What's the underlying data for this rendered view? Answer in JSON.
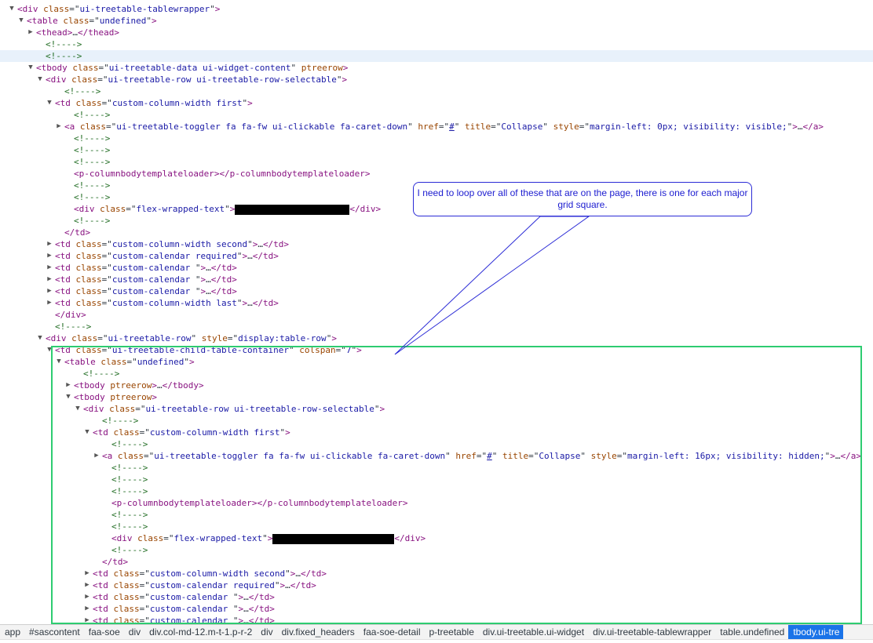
{
  "tree_lines": [
    {
      "indent": 22,
      "toggle": "down",
      "kind": "open",
      "tag": "div",
      "attrs": [
        [
          "class",
          "ui-treetable-tablewrapper"
        ]
      ]
    },
    {
      "indent": 34,
      "toggle": "down",
      "kind": "open",
      "tag": "table",
      "attrs": [
        [
          "class",
          "undefined"
        ]
      ]
    },
    {
      "indent": 46,
      "toggle": "right",
      "kind": "collapsed",
      "tag": "thead",
      "attrs": []
    },
    {
      "indent": 58,
      "kind": "comment",
      "text": "<!---->"
    },
    {
      "indent": 58,
      "kind": "comment",
      "text": "<!---->",
      "highlight": true
    },
    {
      "indent": 46,
      "toggle": "down",
      "kind": "open",
      "tag": "tbody",
      "attrs": [
        [
          "class",
          "ui-treetable-data ui-widget-content"
        ],
        [
          "ptreerow",
          null
        ]
      ]
    },
    {
      "indent": 58,
      "toggle": "down",
      "kind": "open",
      "tag": "div",
      "attrs": [
        [
          "class",
          "ui-treetable-row ui-treetable-row-selectable"
        ]
      ]
    },
    {
      "indent": 82,
      "kind": "comment",
      "text": "<!---->"
    },
    {
      "indent": 70,
      "toggle": "down",
      "kind": "open",
      "tag": "td",
      "attrs": [
        [
          "class",
          "custom-column-width first"
        ]
      ]
    },
    {
      "indent": 94,
      "kind": "comment",
      "text": "<!---->"
    },
    {
      "indent": 82,
      "toggle": "right",
      "kind": "collapsed",
      "tag": "a",
      "attrs": [
        [
          "class",
          "ui-treetable-toggler fa fa-fw ui-clickable fa-caret-down"
        ],
        [
          "href",
          "#"
        ],
        [
          "title",
          "Collapse"
        ],
        [
          "style",
          "margin-left: 0px; visibility: visible;"
        ]
      ]
    },
    {
      "indent": 94,
      "kind": "comment",
      "text": "<!---->"
    },
    {
      "indent": 94,
      "kind": "comment",
      "text": "<!---->"
    },
    {
      "indent": 94,
      "kind": "comment",
      "text": "<!---->"
    },
    {
      "indent": 94,
      "kind": "empty",
      "tag": "p-columnbodytemplateloader",
      "attrs": []
    },
    {
      "indent": 94,
      "kind": "comment",
      "text": "<!---->"
    },
    {
      "indent": 94,
      "kind": "comment",
      "text": "<!---->"
    },
    {
      "indent": 94,
      "kind": "redacted",
      "tag": "div",
      "attrs": [
        [
          "class",
          "flex-wrapped-text"
        ]
      ],
      "redact_width": 146
    },
    {
      "indent": 94,
      "kind": "comment",
      "text": "<!---->"
    },
    {
      "indent": 82,
      "kind": "close",
      "tag": "td"
    },
    {
      "indent": 70,
      "toggle": "right",
      "kind": "collapsed",
      "tag": "td",
      "attrs": [
        [
          "class",
          "custom-column-width second"
        ]
      ]
    },
    {
      "indent": 70,
      "toggle": "right",
      "kind": "collapsed",
      "tag": "td",
      "attrs": [
        [
          "class",
          "custom-calendar required"
        ]
      ]
    },
    {
      "indent": 70,
      "toggle": "right",
      "kind": "collapsed",
      "tag": "td",
      "attrs": [
        [
          "class",
          "custom-calendar "
        ]
      ]
    },
    {
      "indent": 70,
      "toggle": "right",
      "kind": "collapsed",
      "tag": "td",
      "attrs": [
        [
          "class",
          "custom-calendar "
        ]
      ]
    },
    {
      "indent": 70,
      "toggle": "right",
      "kind": "collapsed",
      "tag": "td",
      "attrs": [
        [
          "class",
          "custom-calendar "
        ]
      ]
    },
    {
      "indent": 70,
      "toggle": "right",
      "kind": "collapsed",
      "tag": "td",
      "attrs": [
        [
          "class",
          "custom-column-width last"
        ]
      ]
    },
    {
      "indent": 70,
      "kind": "close",
      "tag": "div"
    },
    {
      "indent": 70,
      "kind": "comment",
      "text": "<!---->"
    },
    {
      "indent": 58,
      "toggle": "down",
      "kind": "open",
      "tag": "div",
      "attrs": [
        [
          "class",
          "ui-treetable-row"
        ],
        [
          "style",
          "display:table-row"
        ]
      ]
    },
    {
      "indent": 70,
      "toggle": "down",
      "kind": "open",
      "tag": "td",
      "attrs": [
        [
          "class",
          "ui-treetable-child-table-container"
        ],
        [
          "colspan",
          "7"
        ]
      ]
    },
    {
      "indent": 82,
      "toggle": "down",
      "kind": "open",
      "tag": "table",
      "attrs": [
        [
          "class",
          "undefined"
        ]
      ]
    },
    {
      "indent": 106,
      "kind": "comment",
      "text": "<!---->"
    },
    {
      "indent": 94,
      "toggle": "right",
      "kind": "collapsed",
      "tag": "tbody",
      "attrs": [
        [
          "ptreerow",
          null
        ]
      ]
    },
    {
      "indent": 94,
      "toggle": "down",
      "kind": "open",
      "tag": "tbody",
      "attrs": [
        [
          "ptreerow",
          null
        ]
      ]
    },
    {
      "indent": 106,
      "toggle": "down",
      "kind": "open",
      "tag": "div",
      "attrs": [
        [
          "class",
          "ui-treetable-row ui-treetable-row-selectable"
        ]
      ]
    },
    {
      "indent": 130,
      "kind": "comment",
      "text": "<!---->"
    },
    {
      "indent": 118,
      "toggle": "down",
      "kind": "open",
      "tag": "td",
      "attrs": [
        [
          "class",
          "custom-column-width first"
        ]
      ]
    },
    {
      "indent": 142,
      "kind": "comment",
      "text": "<!---->"
    },
    {
      "indent": 130,
      "toggle": "right",
      "kind": "collapsed",
      "tag": "a",
      "attrs": [
        [
          "class",
          "ui-treetable-toggler fa fa-fw ui-clickable fa-caret-down"
        ],
        [
          "href",
          "#"
        ],
        [
          "title",
          "Collapse"
        ],
        [
          "style",
          "margin-left: 16px; visibility: hidden;"
        ]
      ]
    },
    {
      "indent": 142,
      "kind": "comment",
      "text": "<!---->"
    },
    {
      "indent": 142,
      "kind": "comment",
      "text": "<!---->"
    },
    {
      "indent": 142,
      "kind": "comment",
      "text": "<!---->"
    },
    {
      "indent": 142,
      "kind": "empty",
      "tag": "p-columnbodytemplateloader",
      "attrs": []
    },
    {
      "indent": 142,
      "kind": "comment",
      "text": "<!---->"
    },
    {
      "indent": 142,
      "kind": "comment",
      "text": "<!---->"
    },
    {
      "indent": 142,
      "kind": "redacted",
      "tag": "div",
      "attrs": [
        [
          "class",
          "flex-wrapped-text"
        ]
      ],
      "redact_width": 155
    },
    {
      "indent": 142,
      "kind": "comment",
      "text": "<!---->"
    },
    {
      "indent": 130,
      "kind": "close",
      "tag": "td"
    },
    {
      "indent": 118,
      "toggle": "right",
      "kind": "collapsed",
      "tag": "td",
      "attrs": [
        [
          "class",
          "custom-column-width second"
        ]
      ]
    },
    {
      "indent": 118,
      "toggle": "right",
      "kind": "collapsed",
      "tag": "td",
      "attrs": [
        [
          "class",
          "custom-calendar required"
        ]
      ]
    },
    {
      "indent": 118,
      "toggle": "right",
      "kind": "collapsed",
      "tag": "td",
      "attrs": [
        [
          "class",
          "custom-calendar "
        ]
      ]
    },
    {
      "indent": 118,
      "toggle": "right",
      "kind": "collapsed",
      "tag": "td",
      "attrs": [
        [
          "class",
          "custom-calendar "
        ]
      ]
    },
    {
      "indent": 118,
      "toggle": "right",
      "kind": "collapsed",
      "tag": "td",
      "attrs": [
        [
          "class",
          "custom-calendar "
        ]
      ]
    }
  ],
  "callout": {
    "text": "I need to loop over all of these that are on the page, there is one for each major grid square."
  },
  "annotation": {
    "box_color": "#2ecc71",
    "callout_color": "#2b2bd6"
  },
  "breadcrumb": [
    "app",
    "#sascontent",
    "faa-soe",
    "div",
    "div.col-md-12.m-t-1.p-r-2",
    "div",
    "div.fixed_headers",
    "faa-soe-detail",
    "p-treetable",
    "div.ui-treetable.ui-widget",
    "div.ui-treetable-tablewrapper",
    "table.undefined",
    "tbody.ui-tre"
  ],
  "breadcrumb_active_index": 12,
  "colors": {
    "tag": "#881280",
    "attr_name": "#994500",
    "attr_value": "#1a1aa6",
    "comment": "#236e25",
    "selected_crumb": "#1a73e8"
  }
}
